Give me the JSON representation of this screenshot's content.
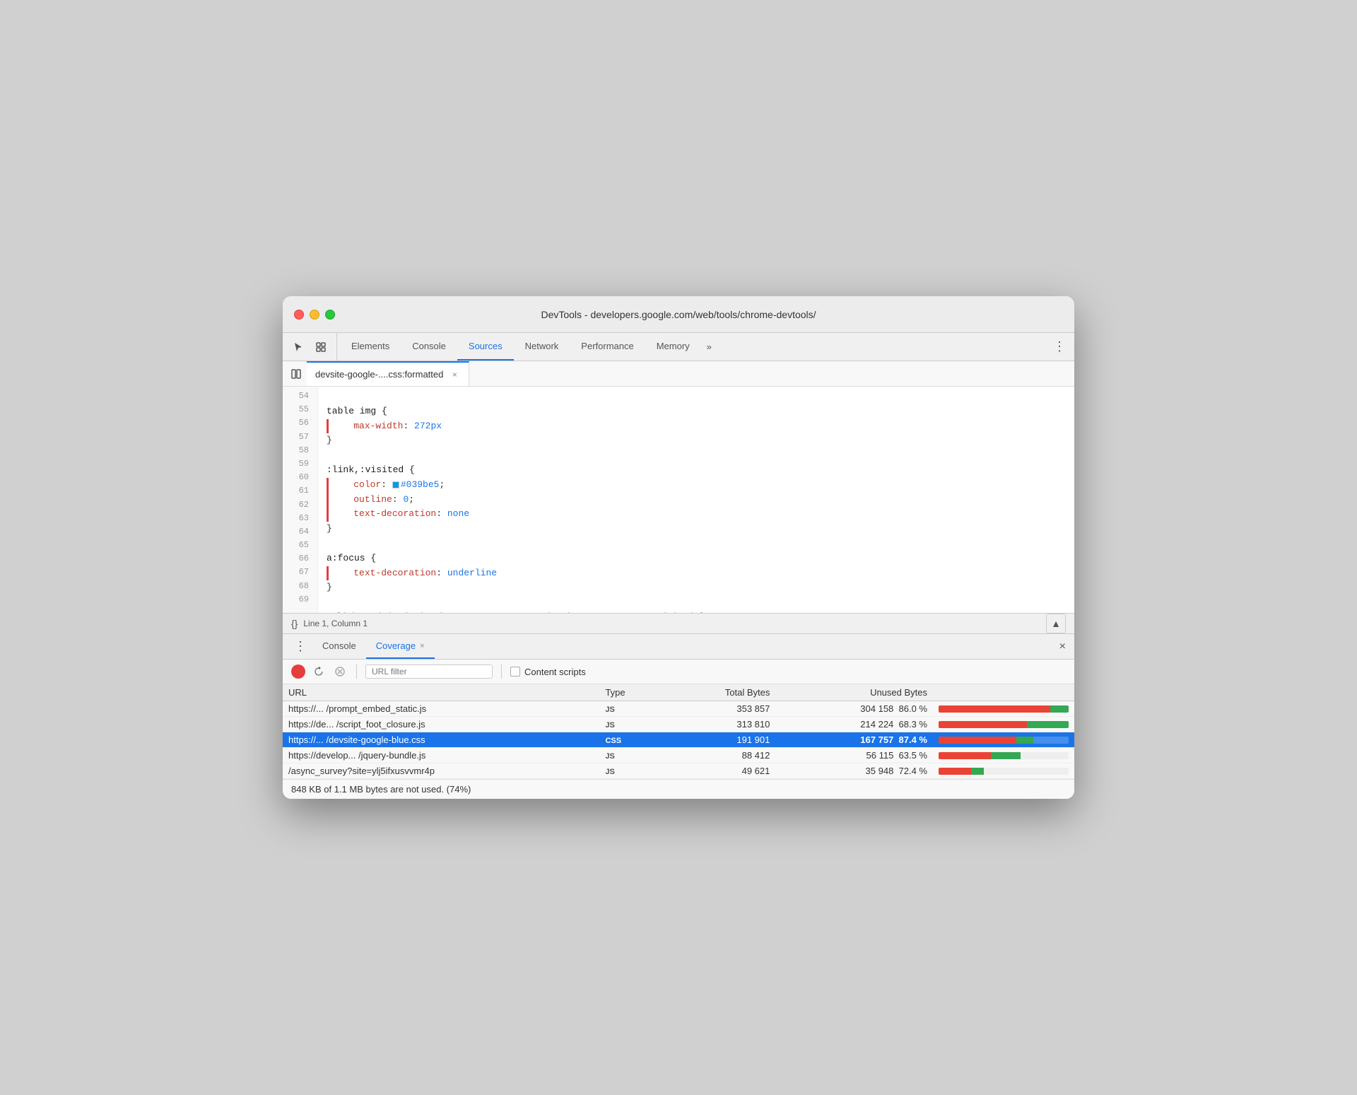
{
  "window": {
    "title": "DevTools - developers.google.com/web/tools/chrome-devtools/"
  },
  "tabs": {
    "items": [
      {
        "label": "Elements",
        "active": false
      },
      {
        "label": "Console",
        "active": false
      },
      {
        "label": "Sources",
        "active": true
      },
      {
        "label": "Network",
        "active": false
      },
      {
        "label": "Performance",
        "active": false
      },
      {
        "label": "Memory",
        "active": false
      },
      {
        "label": "»",
        "active": false
      }
    ]
  },
  "file_tab": {
    "filename": "devsite-google-....css:formatted",
    "close": "×"
  },
  "code": {
    "lines": [
      {
        "num": "54",
        "content": "",
        "tokens": []
      },
      {
        "num": "55",
        "content": "table img {",
        "tokens": [
          {
            "t": "selector",
            "v": "table img {"
          }
        ]
      },
      {
        "num": "56",
        "content": "    max-width: 272px",
        "breakpoint": true,
        "tokens": [
          {
            "t": "property",
            "v": "max-width"
          },
          {
            "t": "punc",
            "v": ": "
          },
          {
            "t": "value",
            "v": "272px"
          }
        ]
      },
      {
        "num": "57",
        "content": "}",
        "tokens": [
          {
            "t": "brace",
            "v": "}"
          }
        ]
      },
      {
        "num": "58",
        "content": "",
        "tokens": []
      },
      {
        "num": "59",
        "content": ":link,:visited {",
        "tokens": [
          {
            "t": "selector",
            "v": ":link,:visited {"
          }
        ]
      },
      {
        "num": "60",
        "content": "    color: #039be5;",
        "breakpoint": true,
        "tokens": [
          {
            "t": "property",
            "v": "color"
          },
          {
            "t": "punc",
            "v": ": "
          },
          {
            "t": "color-swatch",
            "v": "#039be5"
          },
          {
            "t": "value",
            "v": "#039be5"
          },
          {
            "t": "punc",
            "v": ";"
          }
        ]
      },
      {
        "num": "61",
        "content": "    outline: 0;",
        "breakpoint": true,
        "tokens": [
          {
            "t": "property",
            "v": "outline"
          },
          {
            "t": "punc",
            "v": ": "
          },
          {
            "t": "value",
            "v": "0"
          },
          {
            "t": "punc",
            "v": ";"
          }
        ]
      },
      {
        "num": "62",
        "content": "    text-decoration: none",
        "breakpoint": true,
        "tokens": [
          {
            "t": "property",
            "v": "text-decoration"
          },
          {
            "t": "punc",
            "v": ": "
          },
          {
            "t": "string",
            "v": "none"
          }
        ]
      },
      {
        "num": "63",
        "content": "}",
        "tokens": [
          {
            "t": "brace",
            "v": "}"
          }
        ]
      },
      {
        "num": "64",
        "content": "",
        "tokens": []
      },
      {
        "num": "65",
        "content": "a:focus {",
        "tokens": [
          {
            "t": "selector",
            "v": "a:focus {"
          }
        ]
      },
      {
        "num": "66",
        "content": "    text-decoration: underline",
        "breakpoint": true,
        "tokens": [
          {
            "t": "property",
            "v": "text-decoration"
          },
          {
            "t": "punc",
            "v": ": "
          },
          {
            "t": "string",
            "v": "underline"
          }
        ]
      },
      {
        "num": "67",
        "content": "}",
        "tokens": [
          {
            "t": "brace",
            "v": "}"
          }
        ]
      },
      {
        "num": "68",
        "content": "",
        "tokens": []
      },
      {
        "num": "69",
        "content": "a:link,a:visited, devsite-toast-content a, devsite-toast-content-visited {",
        "tokens": [
          {
            "t": "selector",
            "v": "..."
          }
        ]
      }
    ]
  },
  "status_bar": {
    "icon": "{}",
    "position": "Line 1, Column 1"
  },
  "bottom_tabs": {
    "items": [
      {
        "label": "Console",
        "active": false,
        "closable": false
      },
      {
        "label": "Coverage",
        "active": true,
        "closable": true
      }
    ],
    "close_label": "×"
  },
  "coverage": {
    "toolbar": {
      "url_filter_placeholder": "URL filter",
      "content_scripts_label": "Content scripts"
    },
    "table": {
      "headers": [
        "URL",
        "Type",
        "Total Bytes",
        "Unused Bytes",
        ""
      ],
      "rows": [
        {
          "url": "https://... /prompt_embed_static.js",
          "type": "JS",
          "total_bytes": "353 857",
          "unused_bytes": "304 158",
          "unused_pct": "86.0 %",
          "used_pct": 14,
          "unused_bar_pct": 86,
          "selected": false
        },
        {
          "url": "https://de... /script_foot_closure.js",
          "type": "JS",
          "total_bytes": "313 810",
          "unused_bytes": "214 224",
          "unused_pct": "68.3 %",
          "used_pct": 32,
          "unused_bar_pct": 68,
          "selected": false
        },
        {
          "url": "https://... /devsite-google-blue.css",
          "type": "CSS",
          "total_bytes": "191 901",
          "unused_bytes": "167 757",
          "unused_pct": "87.4 %",
          "used_pct": 13,
          "unused_bar_pct": 87,
          "selected": true
        },
        {
          "url": "https://develop... /jquery-bundle.js",
          "type": "JS",
          "total_bytes": "88 412",
          "unused_bytes": "56 115",
          "unused_pct": "63.5 %",
          "used_pct": 37,
          "unused_bar_pct": 63,
          "selected": false
        },
        {
          "url": "/async_survey?site=ylj5ifxusvvmr4p",
          "type": "JS",
          "total_bytes": "49 621",
          "unused_bytes": "35 948",
          "unused_pct": "72.4 %",
          "used_pct": 28,
          "unused_bar_pct": 72,
          "selected": false
        }
      ]
    },
    "footer": "848 KB of 1.1 MB bytes are not used. (74%)"
  }
}
